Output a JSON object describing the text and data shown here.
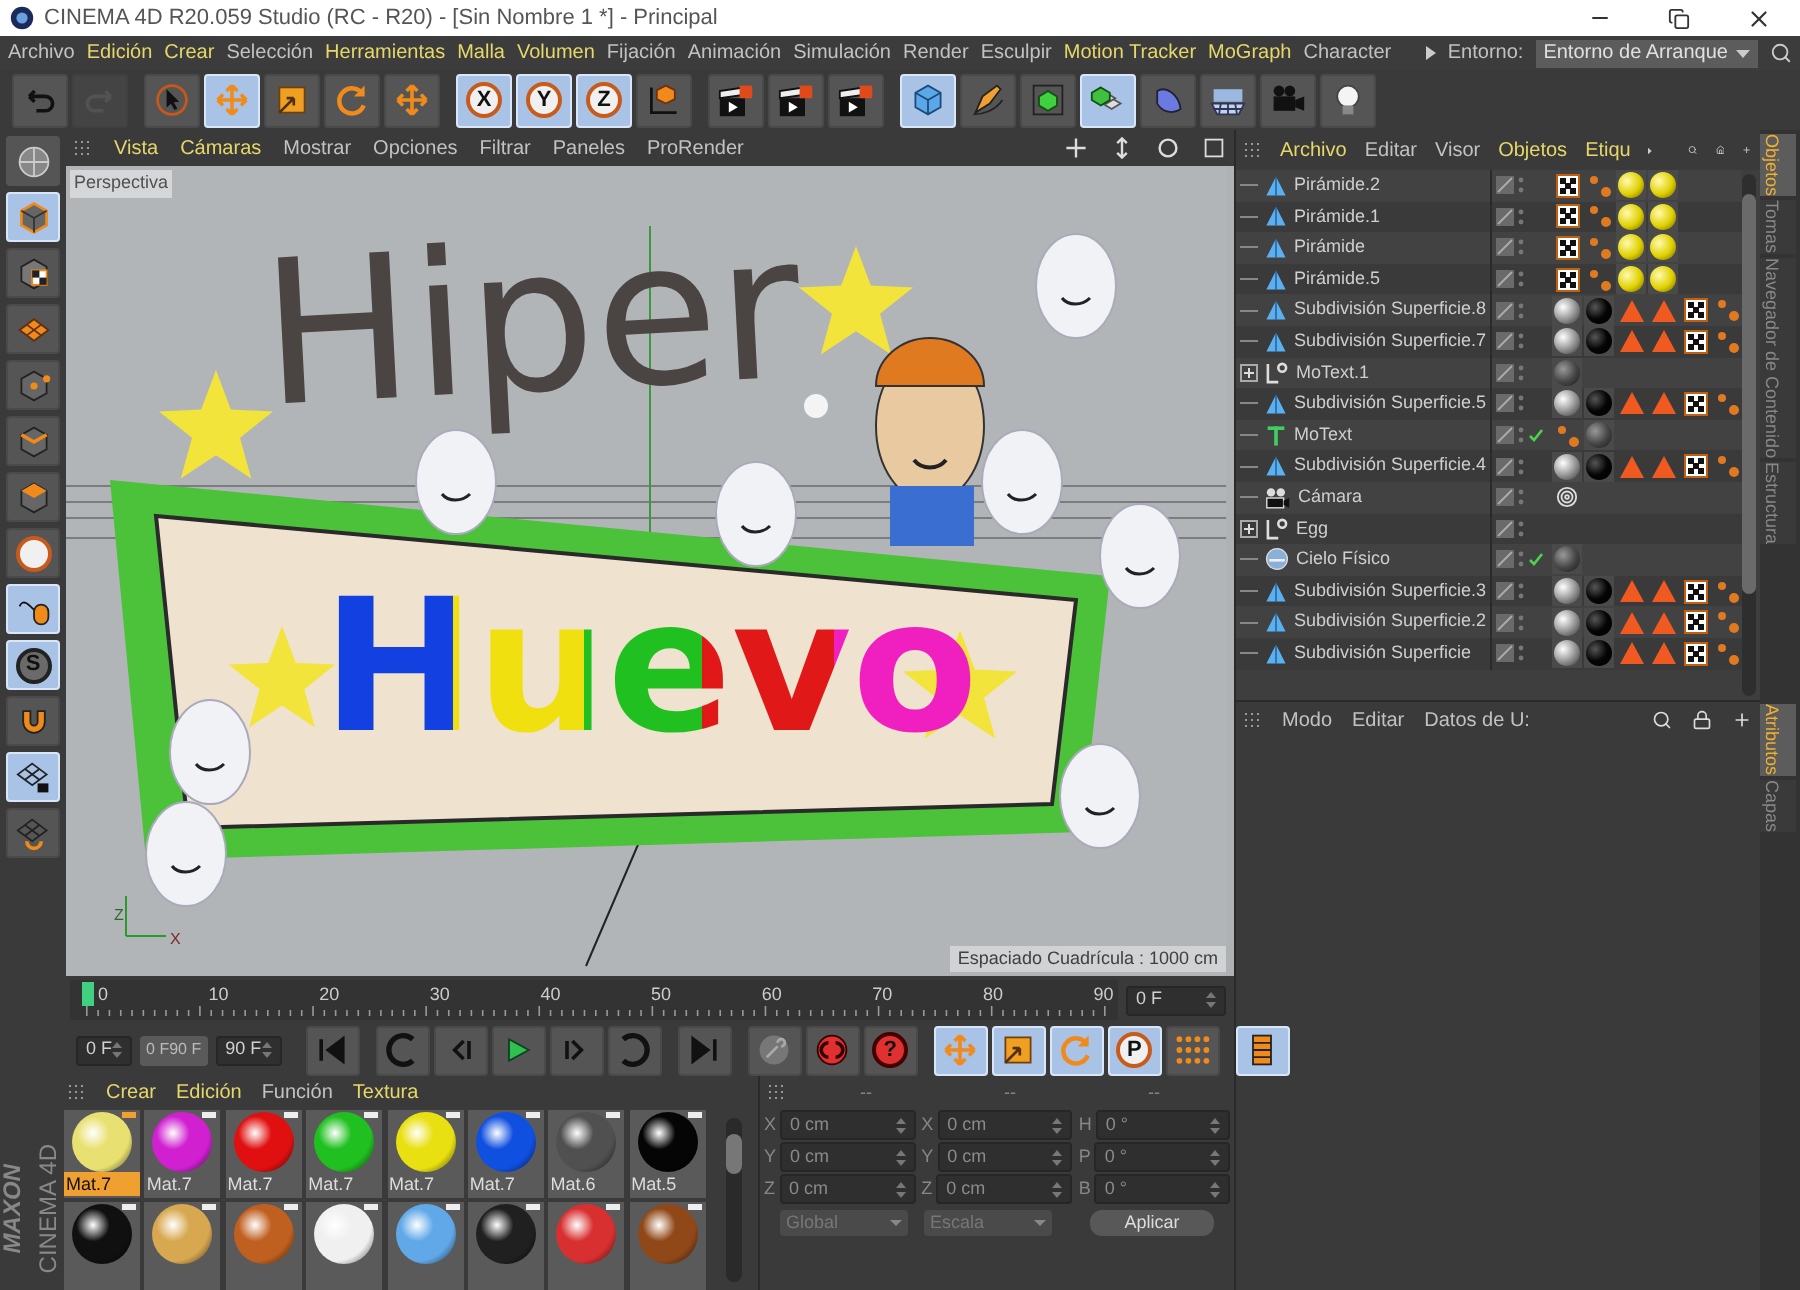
{
  "window": {
    "title": "CINEMA 4D R20.059 Studio (RC - R20) - [Sin Nombre 1 *] - Principal"
  },
  "menu": [
    {
      "label": "Archivo",
      "highlighted": false
    },
    {
      "label": "Edición",
      "highlighted": true
    },
    {
      "label": "Crear",
      "highlighted": true
    },
    {
      "label": "Selección",
      "highlighted": false
    },
    {
      "label": "Herramientas",
      "highlighted": true
    },
    {
      "label": "Malla",
      "highlighted": true
    },
    {
      "label": "Volumen",
      "highlighted": true
    },
    {
      "label": "Fijación",
      "highlighted": false
    },
    {
      "label": "Animación",
      "highlighted": false
    },
    {
      "label": "Simulación",
      "highlighted": false
    },
    {
      "label": "Render",
      "highlighted": false
    },
    {
      "label": "Esculpir",
      "highlighted": false
    },
    {
      "label": "Motion Tracker",
      "highlighted": true
    },
    {
      "label": "MoGraph",
      "highlighted": true
    },
    {
      "label": "Character",
      "highlighted": false
    }
  ],
  "environment": {
    "label": "Entorno:",
    "value": "Entorno de Arranque"
  },
  "toolbar_groups": [
    {
      "items": [
        {
          "kind": "undo",
          "selected": false,
          "disabled": false
        },
        {
          "kind": "redo",
          "selected": false,
          "disabled": true
        }
      ]
    },
    {
      "items": [
        {
          "kind": "select",
          "selected": false,
          "disabled": false
        },
        {
          "kind": "move",
          "selected": true,
          "disabled": false
        },
        {
          "kind": "scale",
          "selected": false,
          "disabled": false
        },
        {
          "kind": "rotate",
          "selected": false,
          "disabled": false
        },
        {
          "kind": "move",
          "selected": false,
          "disabled": false
        }
      ]
    },
    {
      "items": [
        {
          "kind": "axis",
          "label": "X",
          "selected": true,
          "disabled": false
        },
        {
          "kind": "axis",
          "label": "Y",
          "selected": true,
          "disabled": false
        },
        {
          "kind": "axis",
          "label": "Z",
          "selected": true,
          "disabled": false
        },
        {
          "kind": "coord",
          "selected": false,
          "disabled": false
        }
      ]
    },
    {
      "items": [
        {
          "kind": "clap",
          "selected": false,
          "disabled": false
        },
        {
          "kind": "clap",
          "selected": false,
          "disabled": false
        },
        {
          "kind": "clap",
          "selected": false,
          "disabled": false
        }
      ]
    },
    {
      "items": [
        {
          "kind": "cube",
          "selected": true,
          "disabled": false
        },
        {
          "kind": "pen",
          "selected": false,
          "disabled": false
        },
        {
          "kind": "subdiv",
          "selected": false,
          "disabled": false
        },
        {
          "kind": "cloner",
          "selected": true,
          "disabled": false
        },
        {
          "kind": "deformer",
          "selected": false,
          "disabled": false
        },
        {
          "kind": "floor",
          "selected": false,
          "disabled": false
        },
        {
          "kind": "camera",
          "selected": false,
          "disabled": false
        },
        {
          "kind": "light",
          "selected": false,
          "disabled": false
        }
      ]
    }
  ],
  "left_toolbar": [
    {
      "kind": "model",
      "selected": true
    },
    {
      "kind": "texture",
      "selected": false
    },
    {
      "kind": "workplane",
      "selected": false
    },
    {
      "kind": "points",
      "selected": false
    },
    {
      "kind": "edges",
      "selected": false
    },
    {
      "kind": "polygons",
      "selected": false
    },
    {
      "kind": "axis",
      "selected": false
    },
    {
      "kind": "tweak",
      "selected": true
    },
    {
      "kind": "snap",
      "label": "S",
      "selected": true
    },
    {
      "kind": "magnet",
      "selected": false
    },
    {
      "kind": "gridlock",
      "selected": true
    },
    {
      "kind": "gridcycle",
      "selected": false
    }
  ],
  "viewport": {
    "menu": [
      {
        "label": "Vista",
        "highlighted": true
      },
      {
        "label": "Cámaras",
        "highlighted": true
      },
      {
        "label": "Mostrar",
        "highlighted": false
      },
      {
        "label": "Opciones",
        "highlighted": false
      },
      {
        "label": "Filtrar",
        "highlighted": false
      },
      {
        "label": "Paneles",
        "highlighted": false
      },
      {
        "label": "ProRender",
        "highlighted": false
      }
    ],
    "camera_label": "Perspectiva",
    "title_word": "Hiper",
    "sign_word": "Huevo",
    "axis_labels": [
      "Z",
      "X"
    ],
    "grid_spacing": "Espaciado Cuadrícula : 1000 cm"
  },
  "range_slider": {
    "level": 1
  },
  "timeline": {
    "frame_labels": [
      "0",
      "10",
      "20",
      "30",
      "40",
      "50",
      "60",
      "70",
      "80",
      "90"
    ],
    "playhead": {
      "level": 0
    },
    "current_frame": "0 F",
    "start": "0 F",
    "range_start": "0 F",
    "range_end": "90 F",
    "end": "90 F"
  },
  "transport": [
    {
      "kind": "first",
      "selected": false
    },
    {
      "kind": "prevkey",
      "selected": false
    },
    {
      "kind": "prevframe",
      "selected": false
    },
    {
      "kind": "play",
      "selected": false
    },
    {
      "kind": "nextframe",
      "selected": false
    },
    {
      "kind": "nextkey",
      "selected": false
    },
    {
      "kind": "last",
      "selected": false
    },
    {
      "kind": "keyoff",
      "selected": false
    },
    {
      "kind": "record",
      "selected": false
    },
    {
      "kind": "autokey",
      "label": "?",
      "selected": false
    },
    {
      "kind": "move",
      "selected": true
    },
    {
      "kind": "scale",
      "selected": true
    },
    {
      "kind": "rotate",
      "selected": true
    },
    {
      "kind": "param",
      "label": "P",
      "selected": true
    },
    {
      "kind": "pla",
      "selected": false
    },
    {
      "kind": "timeline",
      "selected": true
    }
  ],
  "materials": {
    "menu": [
      {
        "label": "Crear",
        "highlighted": true
      },
      {
        "label": "Edición",
        "highlighted": true
      },
      {
        "label": "Función",
        "highlighted": false
      },
      {
        "label": "Textura",
        "highlighted": true
      }
    ],
    "items": [
      {
        "name": "Mat.7",
        "color": "#e8e070",
        "selected": true
      },
      {
        "name": "Mat.7",
        "color": "#d020d0",
        "selected": false
      },
      {
        "name": "Mat.7",
        "color": "#e01010",
        "selected": false
      },
      {
        "name": "Mat.7",
        "color": "#20c020",
        "selected": false
      },
      {
        "name": "Mat.7",
        "color": "#e8e010",
        "selected": false
      },
      {
        "name": "Mat.7",
        "color": "#1050e0",
        "selected": false
      },
      {
        "name": "Mat.6",
        "color": "#505050",
        "selected": false
      },
      {
        "name": "Mat.5",
        "color": "#050505",
        "selected": false
      },
      {
        "color": "#101010",
        "selected": false
      },
      {
        "color": "#d8a850",
        "selected": false
      },
      {
        "color": "#c06020",
        "selected": false
      },
      {
        "color": "#f0f0f0",
        "selected": false
      },
      {
        "color": "#60a8e8",
        "selected": false
      },
      {
        "color": "#202020",
        "selected": false
      },
      {
        "color": "#d83030",
        "selected": false
      },
      {
        "color": "#904818",
        "selected": false
      }
    ],
    "logo": {
      "brand": "MAXON",
      "product": "CINEMA 4D"
    }
  },
  "coordinates": {
    "disabled": true,
    "headers": [
      "--",
      "--",
      "--"
    ],
    "fields": [
      {
        "axis": "X",
        "value": "0 cm"
      },
      {
        "axis": "X",
        "value": "0 cm"
      },
      {
        "axis": "H",
        "value": "0 °"
      },
      {
        "axis": "Y",
        "value": "0 cm"
      },
      {
        "axis": "Y",
        "value": "0 cm"
      },
      {
        "axis": "P",
        "value": "0 °"
      },
      {
        "axis": "Z",
        "value": "0 cm"
      },
      {
        "axis": "Z",
        "value": "0 cm"
      },
      {
        "axis": "B",
        "value": "0 °"
      }
    ],
    "dropdowns": [
      "Global",
      "Escala"
    ],
    "apply": "Aplicar"
  },
  "objects": {
    "menu": [
      {
        "label": "Archivo",
        "highlighted": true
      },
      {
        "label": "Editar",
        "highlighted": false
      },
      {
        "label": "Visor",
        "highlighted": false
      },
      {
        "label": "Objetos",
        "highlighted": true
      },
      {
        "label": "Etiqu",
        "highlighted": true
      }
    ],
    "rows": [
      {
        "name": "Pirámide.2",
        "kind": "poly",
        "check": false,
        "tags": [
          {
            "kind": "checker"
          },
          {
            "kind": "dots"
          },
          {
            "kind": "yellow"
          },
          {
            "kind": "yellow"
          }
        ]
      },
      {
        "name": "Pirámide.1",
        "kind": "poly",
        "check": false,
        "tags": [
          {
            "kind": "checker"
          },
          {
            "kind": "dots"
          },
          {
            "kind": "yellow"
          },
          {
            "kind": "yellow"
          }
        ]
      },
      {
        "name": "Pirámide",
        "kind": "poly",
        "check": false,
        "tags": [
          {
            "kind": "checker"
          },
          {
            "kind": "dots"
          },
          {
            "kind": "yellow"
          },
          {
            "kind": "yellow"
          }
        ]
      },
      {
        "name": "Pirámide.5",
        "kind": "poly",
        "check": false,
        "tags": [
          {
            "kind": "checker"
          },
          {
            "kind": "dots"
          },
          {
            "kind": "yellow"
          },
          {
            "kind": "yellow"
          }
        ]
      },
      {
        "name": "Subdivisión Superficie.8",
        "kind": "poly",
        "check": false,
        "tags": [
          {
            "kind": "chrome"
          },
          {
            "kind": "black"
          },
          {
            "kind": "tri"
          },
          {
            "kind": "tri"
          },
          {
            "kind": "checker"
          },
          {
            "kind": "dots"
          }
        ]
      },
      {
        "name": "Subdivisión Superficie.7",
        "kind": "poly",
        "check": false,
        "tags": [
          {
            "kind": "chrome"
          },
          {
            "kind": "black"
          },
          {
            "kind": "tri"
          },
          {
            "kind": "tri"
          },
          {
            "kind": "checker"
          },
          {
            "kind": "dots"
          }
        ]
      },
      {
        "name": "MoText.1",
        "kind": "null",
        "expanded": false,
        "check": false,
        "tags": [
          {
            "kind": "grey"
          }
        ]
      },
      {
        "name": "Subdivisión Superficie.5",
        "kind": "poly",
        "check": false,
        "tags": [
          {
            "kind": "chrome"
          },
          {
            "kind": "black"
          },
          {
            "kind": "tri"
          },
          {
            "kind": "tri"
          },
          {
            "kind": "checker"
          },
          {
            "kind": "dots"
          }
        ]
      },
      {
        "name": "MoText",
        "kind": "text",
        "check": true,
        "tags": [
          {
            "kind": "dots"
          },
          {
            "kind": "grey"
          }
        ]
      },
      {
        "name": "Subdivisión Superficie.4",
        "kind": "poly",
        "check": false,
        "tags": [
          {
            "kind": "chrome"
          },
          {
            "kind": "black"
          },
          {
            "kind": "tri"
          },
          {
            "kind": "tri"
          },
          {
            "kind": "checker"
          },
          {
            "kind": "dots"
          }
        ]
      },
      {
        "name": "Cámara",
        "kind": "camera",
        "check": false,
        "tags": [
          {
            "kind": "target"
          }
        ]
      },
      {
        "name": "Egg",
        "kind": "null",
        "expanded": false,
        "check": false
      },
      {
        "name": "Cielo Físico",
        "kind": "sky",
        "check": true,
        "tags": [
          {
            "kind": "grey"
          }
        ]
      },
      {
        "name": "Subdivisión Superficie.3",
        "kind": "poly",
        "check": false,
        "tags": [
          {
            "kind": "chrome"
          },
          {
            "kind": "black"
          },
          {
            "kind": "tri"
          },
          {
            "kind": "tri"
          },
          {
            "kind": "checker"
          },
          {
            "kind": "dots"
          }
        ]
      },
      {
        "name": "Subdivisión Superficie.2",
        "kind": "poly",
        "check": false,
        "tags": [
          {
            "kind": "chrome"
          },
          {
            "kind": "black"
          },
          {
            "kind": "tri"
          },
          {
            "kind": "tri"
          },
          {
            "kind": "checker"
          },
          {
            "kind": "dots"
          }
        ]
      },
      {
        "name": "Subdivisión Superficie",
        "kind": "poly",
        "check": false,
        "tags": [
          {
            "kind": "chrome"
          },
          {
            "kind": "black"
          },
          {
            "kind": "tri"
          },
          {
            "kind": "tri"
          },
          {
            "kind": "checker"
          },
          {
            "kind": "dots"
          }
        ]
      }
    ]
  },
  "attributes": {
    "menu": [
      {
        "label": "Modo",
        "highlighted": false
      },
      {
        "label": "Editar",
        "highlighted": false
      },
      {
        "label": "Datos de U:",
        "highlighted": false
      }
    ]
  },
  "side_tabs_top": [
    {
      "label": "Objetos",
      "selected": true
    },
    {
      "label": "Tomas",
      "selected": false
    },
    {
      "label": "Navegador de Contenido",
      "selected": false
    },
    {
      "label": "Estructura",
      "selected": false
    }
  ],
  "side_tabs_bottom": [
    {
      "label": "Atributos",
      "selected": true
    },
    {
      "label": "Capas",
      "selected": false
    }
  ]
}
